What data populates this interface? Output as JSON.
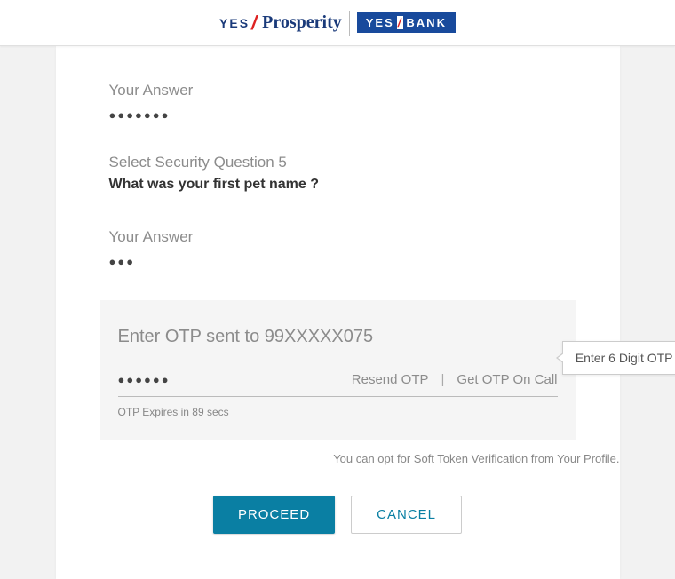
{
  "header": {
    "logo1_yes": "YES",
    "logo1_prosperity": "Prosperity",
    "logo2_yes": "YES",
    "logo2_bank": "BANK"
  },
  "q4": {
    "answer_label": "Your Answer",
    "answer_mask": "●●●●●●●"
  },
  "q5": {
    "select_label": "Select Security Question 5",
    "question": "What was your first pet name ?",
    "answer_label": "Your Answer",
    "answer_mask": "●●●"
  },
  "otp": {
    "title": "Enter OTP sent to 99XXXXX075",
    "value_mask": "●●●●●●",
    "resend": "Resend OTP",
    "separator": "|",
    "on_call": "Get OTP On Call",
    "expiry": "OTP Expires in 89 secs",
    "tooltip": "Enter 6 Digit OTP"
  },
  "soft_token_note": "You can opt for Soft Token Verification from Your Profile.",
  "buttons": {
    "proceed": "PROCEED",
    "cancel": "CANCEL"
  }
}
